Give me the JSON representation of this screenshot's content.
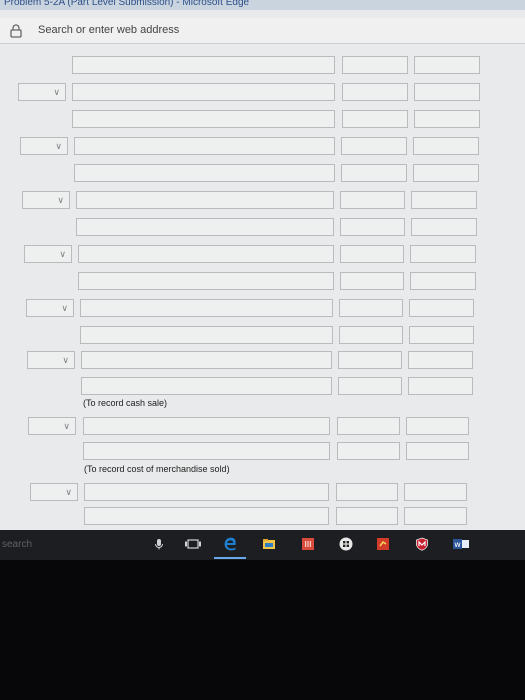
{
  "window": {
    "title": "Problem 5-2A (Part Level Submission) - Microsoft Edge"
  },
  "browser": {
    "address_placeholder": "Search or enter web address"
  },
  "journal": {
    "notes": {
      "cash_sale": "(To record cash sale)",
      "cost_of_merchandise": "(To record cost of merchandise sold)"
    }
  },
  "taskbar": {
    "search_placeholder": "search",
    "icons": [
      "microphone-icon",
      "task-view-icon",
      "edge-icon",
      "file-explorer-icon",
      "store-icon",
      "calculator-icon",
      "app-icon",
      "mcafee-icon",
      "word-icon"
    ]
  },
  "colors": {
    "screen_bg": "#e9eaeb",
    "field_border": "#b9bcbf",
    "taskbar": "#1d1e22",
    "edge_blue": "#1e7fd0",
    "store_red": "#d84a3a"
  }
}
